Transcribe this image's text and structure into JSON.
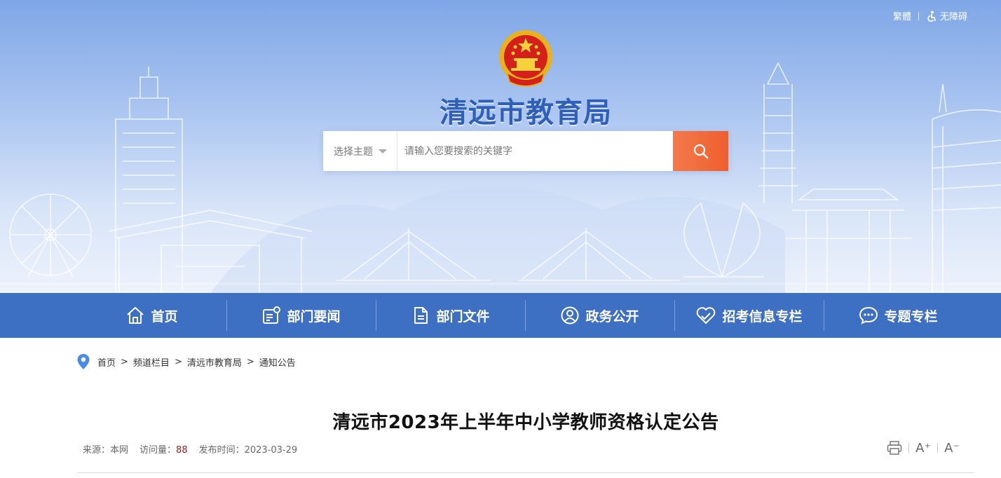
{
  "header": {
    "traditional_label": "繁體",
    "accessibility_label": "无障碍",
    "site_title": "清远市教育局",
    "colors": {
      "title": "#2f5fb7",
      "search_button": "#ef6a38",
      "nav_bg": "#3d6fc3"
    }
  },
  "search": {
    "topic_label": "选择主题",
    "placeholder": "请输入您要搜索的关键字",
    "button_icon": "search-icon"
  },
  "nav": {
    "items": [
      {
        "label": "首页",
        "icon": "home-icon"
      },
      {
        "label": "部门要闻",
        "icon": "news-icon"
      },
      {
        "label": "部门文件",
        "icon": "document-icon"
      },
      {
        "label": "政务公开",
        "icon": "user-circle-icon"
      },
      {
        "label": "招考信息专栏",
        "icon": "heart-hand-icon"
      },
      {
        "label": "专题专栏",
        "icon": "chat-bubble-icon"
      }
    ]
  },
  "breadcrumb": {
    "items": [
      "首页",
      "频道栏目",
      "清远市教育局",
      "通知公告"
    ],
    "separator": ">"
  },
  "article": {
    "title": "清远市2023年上半年中小学教师资格认定公告",
    "source_label": "来源：",
    "source_value": "本网",
    "views_label": "访问量：",
    "views_value": "88",
    "date_label": "发布时间：",
    "date_value": "2023-03-29",
    "tools": {
      "print_icon": "print-icon",
      "font_increase": "A⁺",
      "font_decrease": "A⁻"
    }
  }
}
